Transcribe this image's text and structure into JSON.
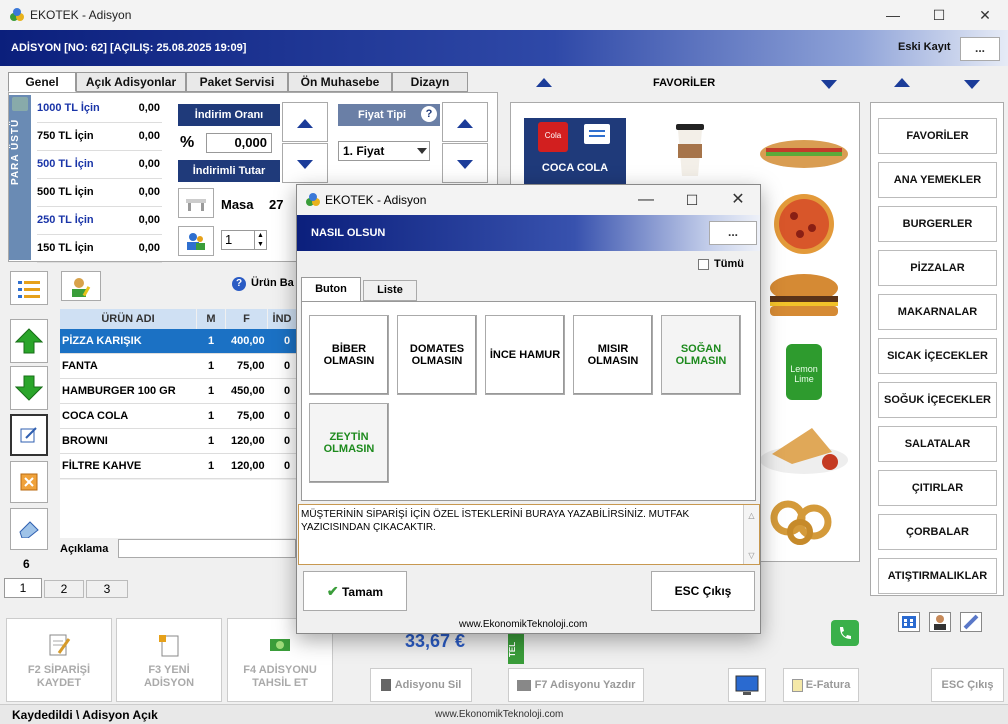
{
  "window": {
    "title": "EKOTEK - Adisyon",
    "min": "—",
    "max": "☐",
    "close": "✕"
  },
  "header": {
    "title": "ADİSYON [NO: 62] [AÇILIŞ: 25.08.2025 19:09]",
    "eski_kayit": "Eski Kayıt",
    "dots": "..."
  },
  "tabs": [
    "Genel",
    "Açık Adisyonlar",
    "Paket Servisi",
    "Ön Muhasebe",
    "Dizayn"
  ],
  "para_ustu": {
    "label": "PARA ÜSTÜ",
    "rows": [
      {
        "label": "1000 TL İçin",
        "value": "0,00"
      },
      {
        "label": "750 TL İçin",
        "value": "0,00"
      },
      {
        "label": "500 TL İçin",
        "value": "0,00"
      },
      {
        "label": "500 TL İçin",
        "value": "0,00"
      },
      {
        "label": "250 TL İçin",
        "value": "0,00"
      },
      {
        "label": "150 TL İçin",
        "value": "0,00"
      }
    ]
  },
  "discount": {
    "rate_label": "İndirim Oranı",
    "percent_sign": "%",
    "rate_value": "0,000",
    "amount_label": "İndirimli Tutar"
  },
  "price_type": {
    "label": "Fiyat Tipi",
    "help": "?",
    "selected": "1. Fiyat"
  },
  "table_info": {
    "masa_label": "Masa",
    "masa_value": "27",
    "person_value": "1"
  },
  "urun_bar": "Ürün Ba",
  "order_table": {
    "headers": [
      "ÜRÜN ADI",
      "M",
      "F",
      "İND"
    ],
    "rows": [
      {
        "name": "PİZZA KARIŞIK",
        "m": "1",
        "f": "400,00",
        "ind": "0"
      },
      {
        "name": "FANTA",
        "m": "1",
        "f": "75,00",
        "ind": "0"
      },
      {
        "name": "HAMBURGER 100 GR",
        "m": "1",
        "f": "450,00",
        "ind": "0"
      },
      {
        "name": "COCA COLA",
        "m": "1",
        "f": "75,00",
        "ind": "0"
      },
      {
        "name": "BROWNI",
        "m": "1",
        "f": "120,00",
        "ind": "0"
      },
      {
        "name": "FİLTRE KAHVE",
        "m": "1",
        "f": "120,00",
        "ind": "0"
      }
    ]
  },
  "aciklama": "Açıklama",
  "count": "6",
  "pages": [
    "1",
    "2",
    "3"
  ],
  "favorites": {
    "title": "FAVORİLER",
    "coca_cola": "COCA COLA"
  },
  "categories": [
    "FAVORİLER",
    "ANA YEMEKLER",
    "BURGERLER",
    "PİZZALAR",
    "MAKARNALAR",
    "SICAK İÇECEKLER",
    "SOĞUK İÇECEKLER",
    "SALATALAR",
    "ÇITIRLAR",
    "ÇORBALAR",
    "ATIŞTIRMALIKLAR"
  ],
  "bottom": {
    "f2": "F2 SİPARİŞİ KAYDET",
    "f3": "F3 YENİ ADİSYON",
    "f4": "F4 ADİSYONU TAHSİL ET",
    "total": "33,67 €",
    "tel": "TEL",
    "adisyon_sil": "Adisyonu Sil",
    "f7": "F7 Adisyonu Yazdır",
    "efatura": "E-Fatura",
    "esc": "ESC Çıkış"
  },
  "status": {
    "left": "Kaydedildi \\ Adisyon Açık",
    "center": "www.EkonomikTeknoloji.com"
  },
  "modal": {
    "title": "EKOTEK - Adisyon",
    "header": "NASIL OLSUN",
    "dots": "...",
    "tumu": "Tümü",
    "tabs": [
      "Buton",
      "Liste"
    ],
    "options": [
      "BİBER OLMASIN",
      "DOMATES OLMASIN",
      "İNCE HAMUR",
      "MISIR OLMASIN",
      "SOĞAN OLMASIN",
      "ZEYTİN OLMASIN"
    ],
    "note": "MÜŞTERİNİN SİPARİŞİ İÇİN ÖZEL İSTEKLERİNİ BURAYA YAZABİLİRSİNİZ. MUTFAK YAZICISINDAN ÇIKACAKTIR.",
    "ok": "Tamam",
    "cancel": "ESC Çıkış",
    "footer": "www.EkonomikTeknoloji.com"
  }
}
